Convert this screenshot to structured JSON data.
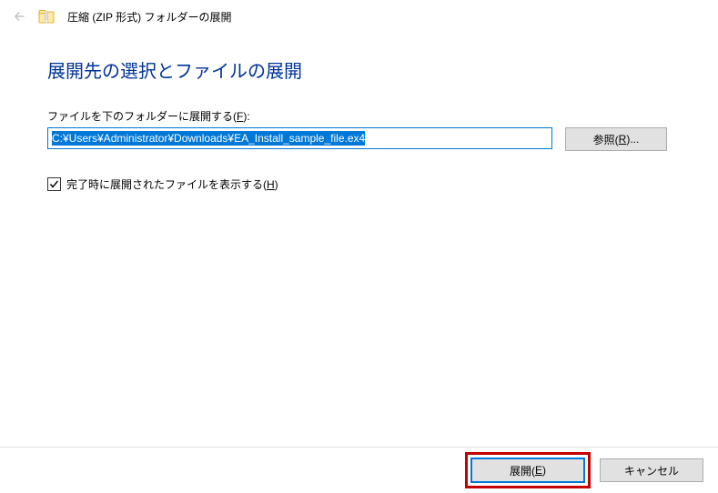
{
  "titlebar": {
    "title": "圧縮 (ZIP 形式) フォルダーの展開"
  },
  "heading": "展開先の選択とファイルの展開",
  "path_field": {
    "label_prefix": "ファイルを下のフォルダーに展開する(",
    "label_key": "F",
    "label_suffix": "):",
    "value": "C:¥Users¥Administrator¥Downloads¥EA_Install_sample_file.ex4"
  },
  "browse": {
    "label_prefix": "参照(",
    "label_key": "R",
    "label_suffix": ")..."
  },
  "checkbox": {
    "checked": true,
    "label_prefix": "完了時に展開されたファイルを表示する(",
    "label_key": "H",
    "label_suffix": ")"
  },
  "footer": {
    "extract_prefix": "展開(",
    "extract_key": "E",
    "extract_suffix": ")",
    "cancel": "キャンセル"
  }
}
